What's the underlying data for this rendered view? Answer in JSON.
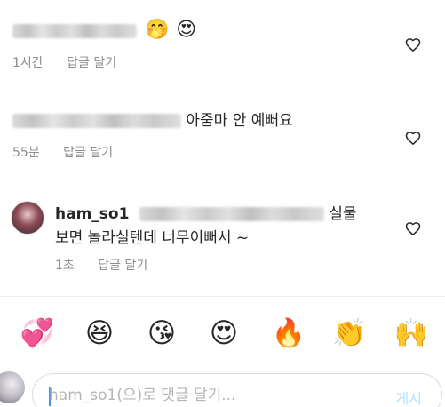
{
  "comments": [
    {
      "text_after_blur": "",
      "inline_emojis": [
        "🤭",
        "😍"
      ],
      "time": "1시간",
      "reply_label": "답글 달기"
    },
    {
      "text_after_blur": "아줌마 안 예뻐요",
      "time": "55분",
      "reply_label": "답글 달기"
    },
    {
      "username": "ham_so1",
      "text_after_blur": "실물",
      "text_line2": "보면 놀라실텐데 너무이뻐서 ~",
      "time": "1초",
      "reply_label": "답글 달기"
    }
  ],
  "quick_emojis": [
    "💞",
    "😆",
    "😘",
    "😍",
    "🔥",
    "👏",
    "🙌"
  ],
  "input": {
    "placeholder": "ham_so1(으)로 댓글 달기...",
    "value": ""
  },
  "post_label": "게시",
  "colors": {
    "text": "#262626",
    "meta": "#8e8e8e",
    "post_disabled": "#b2dffc",
    "caret": "#3897f0"
  },
  "icons": {
    "like": "heart-outline-icon"
  }
}
